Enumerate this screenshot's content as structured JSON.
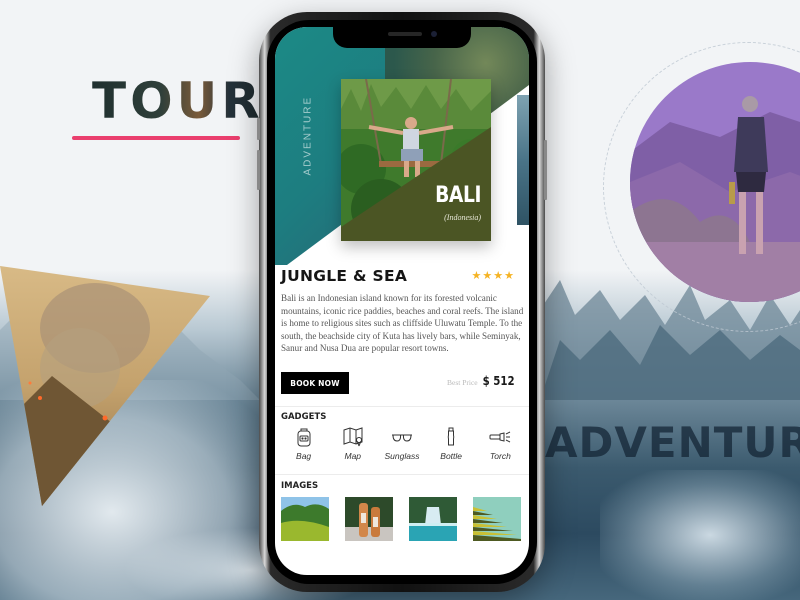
{
  "background": {
    "tour_title": "TOUR",
    "adventure_text": "ADVENTURE",
    "accent_color": "#ea3f6e"
  },
  "app": {
    "hero": {
      "vertical_label": "ADVENTURE",
      "destination": "BALI",
      "country": "(Indonesia)"
    },
    "tour": {
      "title": "JUNGLE & SEA",
      "rating_stars": 4,
      "stars_text": "★★★★",
      "description": "Bali is an Indonesian island known for its forested volcanic mountains, iconic rice paddies, beaches and coral reefs. The island is home to religious sites such as cliffside Uluwatu Temple. To the south, the beachside city of Kuta has lively bars, while Seminyak, Sanur and Nusa Dua are popular resort towns.",
      "book_label": "BOOK NOW",
      "price_label": "Best Price",
      "price": "$ 512"
    },
    "gadgets": {
      "title": "GADGETS",
      "items": [
        {
          "label": "Bag",
          "icon": "backpack-icon"
        },
        {
          "label": "Map",
          "icon": "map-icon"
        },
        {
          "label": "Sunglass",
          "icon": "sunglasses-icon"
        },
        {
          "label": "Bottle",
          "icon": "bottle-icon"
        },
        {
          "label": "Torch",
          "icon": "flashlight-icon"
        }
      ]
    },
    "images": {
      "title": "IMAGES",
      "items": [
        {
          "subject": "jungle hills"
        },
        {
          "subject": "tigers"
        },
        {
          "subject": "waterfall"
        },
        {
          "subject": "rice terraces"
        }
      ]
    },
    "colors": {
      "hero_teal": "#1c8a86",
      "card_olive": "#4b5524",
      "star": "#f5b324"
    }
  }
}
